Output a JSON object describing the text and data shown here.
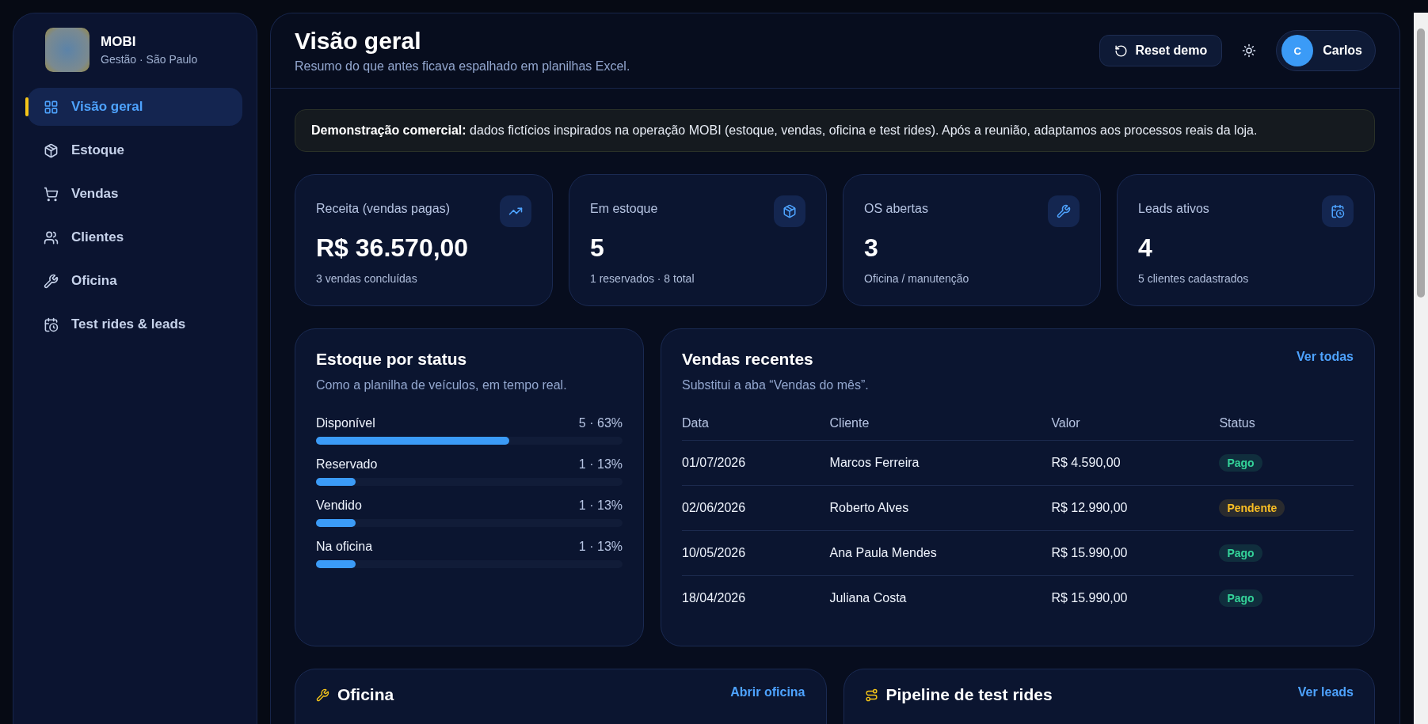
{
  "sidebar": {
    "brand": {
      "name": "MOBI",
      "subtitle": "Gestão · São Paulo"
    },
    "items": [
      {
        "label": "Visão geral",
        "selected": true
      },
      {
        "label": "Estoque",
        "selected": false
      },
      {
        "label": "Vendas",
        "selected": false
      },
      {
        "label": "Clientes",
        "selected": false
      },
      {
        "label": "Oficina",
        "selected": false
      },
      {
        "label": "Test rides & leads",
        "selected": false
      }
    ]
  },
  "header": {
    "title": "Visão geral",
    "subtitle": "Resumo do que antes ficava espalhado em planilhas Excel.",
    "reset_button": "Reset demo",
    "user": {
      "initial": "C",
      "name": "Carlos"
    }
  },
  "notice": "**Demonstração comercial:** dados fictícios inspirados na operação MOBI (estoque, vendas, oficina e test rides). Após a reunião, adaptamos aos processos reais da loja.",
  "kpis": [
    {
      "label": "Receita (vendas pagas)",
      "value": "R$ 36.570,00",
      "note": "3 vendas concluídas"
    },
    {
      "label": "Em estoque",
      "value": "5",
      "note": "1 reservados · 8 total"
    },
    {
      "label": "OS abertas",
      "value": "3",
      "note": "Oficina / manutenção"
    },
    {
      "label": "Leads ativos",
      "value": "4",
      "note": "5 clientes cadastrados"
    }
  ],
  "stock": {
    "title": "Estoque por status",
    "subtitle": "Como a planilha de veículos, em tempo real.",
    "rows": [
      {
        "label": "Disponível",
        "reading": "5 · 63%",
        "level": 0.63
      },
      {
        "label": "Reservado",
        "reading": "1 · 13%",
        "level": 0.13
      },
      {
        "label": "Vendido",
        "reading": "1 · 13%",
        "level": 0.13
      },
      {
        "label": "Na oficina",
        "reading": "1 · 13%",
        "level": 0.13
      }
    ]
  },
  "sales": {
    "title": "Vendas recentes",
    "subtitle": "Substitui a aba “Vendas do mês”.",
    "link": "Ver todas",
    "columns": [
      "Data",
      "Cliente",
      "Valor",
      "Status"
    ],
    "rows": [
      {
        "date": "01/07/2026",
        "client": "Marcos Ferreira",
        "value": "R$ 4.590,00",
        "status": {
          "label": "Pago",
          "color": "#34d399"
        }
      },
      {
        "date": "02/06/2026",
        "client": "Roberto Alves",
        "value": "R$ 12.990,00",
        "status": {
          "label": "Pendente",
          "color": "#fbbf24"
        }
      },
      {
        "date": "10/05/2026",
        "client": "Ana Paula Mendes",
        "value": "R$ 15.990,00",
        "status": {
          "label": "Pago",
          "color": "#34d399"
        }
      },
      {
        "date": "18/04/2026",
        "client": "Juliana Costa",
        "value": "R$ 15.990,00",
        "status": {
          "label": "Pago",
          "color": "#34d399"
        }
      }
    ]
  },
  "bottom_cards": [
    {
      "title": "Oficina",
      "link": "Abrir oficina"
    },
    {
      "title": "Pipeline de test rides",
      "link": "Ver leads"
    }
  ]
}
